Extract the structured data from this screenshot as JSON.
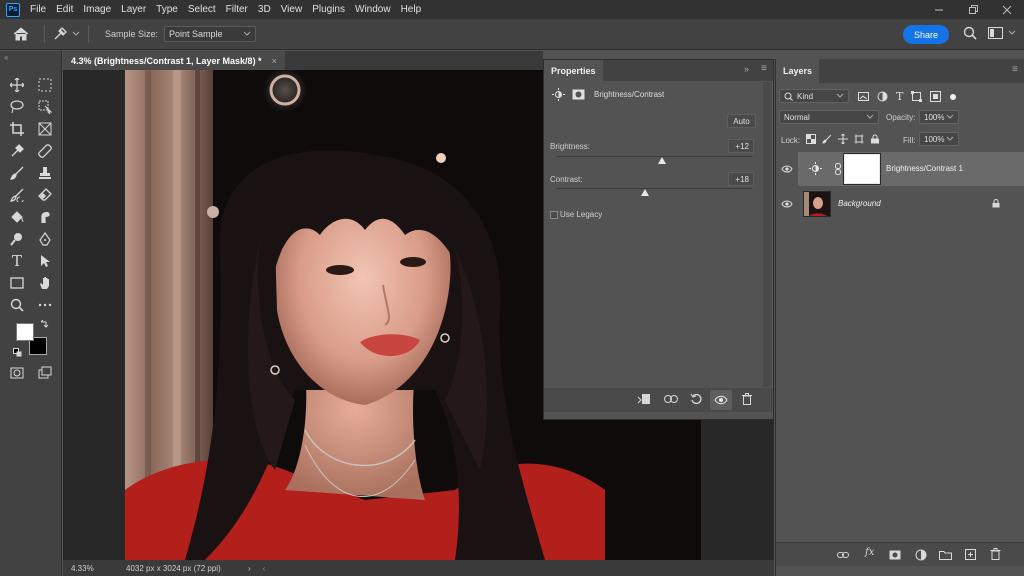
{
  "app": {
    "logo_text": "Ps"
  },
  "menu": [
    "File",
    "Edit",
    "Image",
    "Layer",
    "Type",
    "Select",
    "Filter",
    "3D",
    "View",
    "Plugins",
    "Window",
    "Help"
  ],
  "options_bar": {
    "sample_size_label": "Sample Size:",
    "sample_size_value": "Point Sample",
    "share_label": "Share"
  },
  "document": {
    "tab_title": "4.3% (Brightness/Contrast 1, Layer Mask/8) *",
    "close_glyph": "×"
  },
  "status_bar": {
    "zoom": "4.33%",
    "dimensions": "4032 px x 3024 px (72 ppi)"
  },
  "properties": {
    "tab_label": "Properties",
    "adjustment_name": "Brightness/Contrast",
    "auto_label": "Auto",
    "brightness_label": "Brightness:",
    "brightness_value": "+12",
    "brightness": 12,
    "contrast_label": "Contrast:",
    "contrast_value": "+18",
    "contrast": 18,
    "use_legacy_label": "Use Legacy",
    "use_legacy_checked": false
  },
  "layers": {
    "tab_label": "Layers",
    "filter_kind": "Kind",
    "blend_mode": "Normal",
    "opacity_label": "Opacity:",
    "opacity_value": "100%",
    "lock_label": "Lock:",
    "fill_label": "Fill:",
    "fill_value": "100%",
    "items": [
      {
        "name": "Brightness/Contrast 1",
        "visible": true,
        "selected": true,
        "type": "adjustment"
      },
      {
        "name": "Background",
        "visible": true,
        "selected": false,
        "type": "pixel",
        "locked": true
      }
    ]
  },
  "colors": {
    "accent": "#1473e6",
    "foreground_swatch": "#ffffff",
    "background_swatch": "#000000"
  }
}
